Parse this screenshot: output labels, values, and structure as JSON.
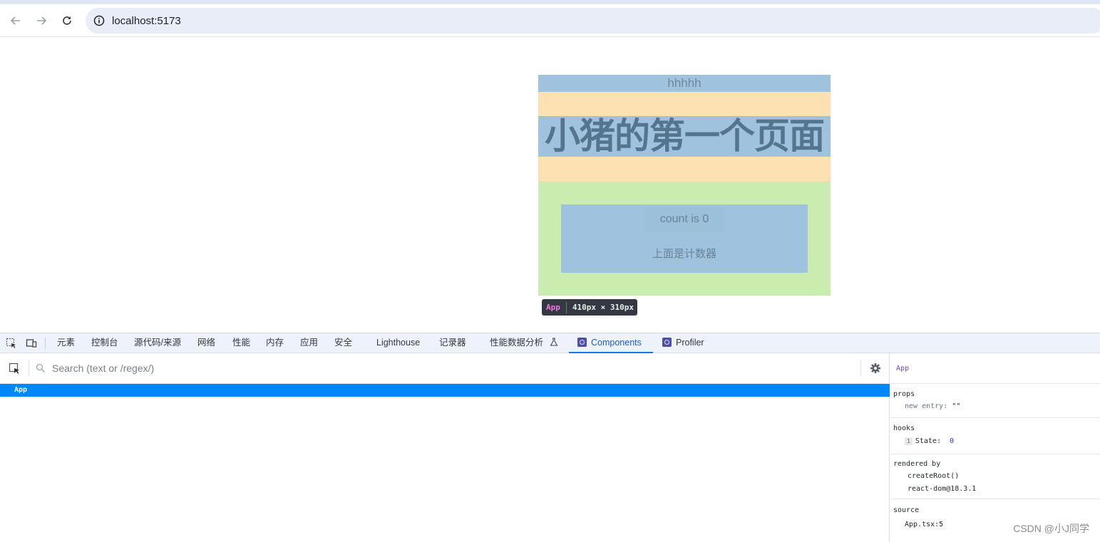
{
  "browser": {
    "url": "localhost:5173"
  },
  "page": {
    "header_text": "hhhhh",
    "title": "小猪的第一个页面",
    "count_button": "count is 0",
    "card_text": "上面是计数器"
  },
  "inspector_tooltip": {
    "component": "App",
    "dimensions": "410px × 310px"
  },
  "devtools": {
    "tabs": [
      "元素",
      "控制台",
      "源代码/来源",
      "网络",
      "性能",
      "内存",
      "应用",
      "安全",
      "Lighthouse",
      "记录器",
      "性能数据分析",
      "Components",
      "Profiler"
    ],
    "active_tab": "Components",
    "search": {
      "placeholder": "Search (text or /regex/)"
    },
    "tree": [
      {
        "label": "App",
        "selected": true
      }
    ],
    "side": {
      "component": "App",
      "props_title": "props",
      "props": [
        {
          "key": "new entry",
          "value": "\"\""
        }
      ],
      "hooks_title": "hooks",
      "hooks": [
        {
          "index": "1",
          "key": "State",
          "value": "0"
        }
      ],
      "rendered_by_title": "rendered by",
      "rendered_by": [
        "createRoot()",
        "react-dom@18.3.1"
      ],
      "source_title": "source",
      "source": "App.tsx:5"
    }
  },
  "watermark": "CSDN @小J同学",
  "colors": {
    "header_bg": "#9fc3de",
    "margin_bg": "#fde1b2",
    "padding_bg": "#cbecaf",
    "selected_row": "#0088fa",
    "active_tab": "#1a73e8"
  }
}
